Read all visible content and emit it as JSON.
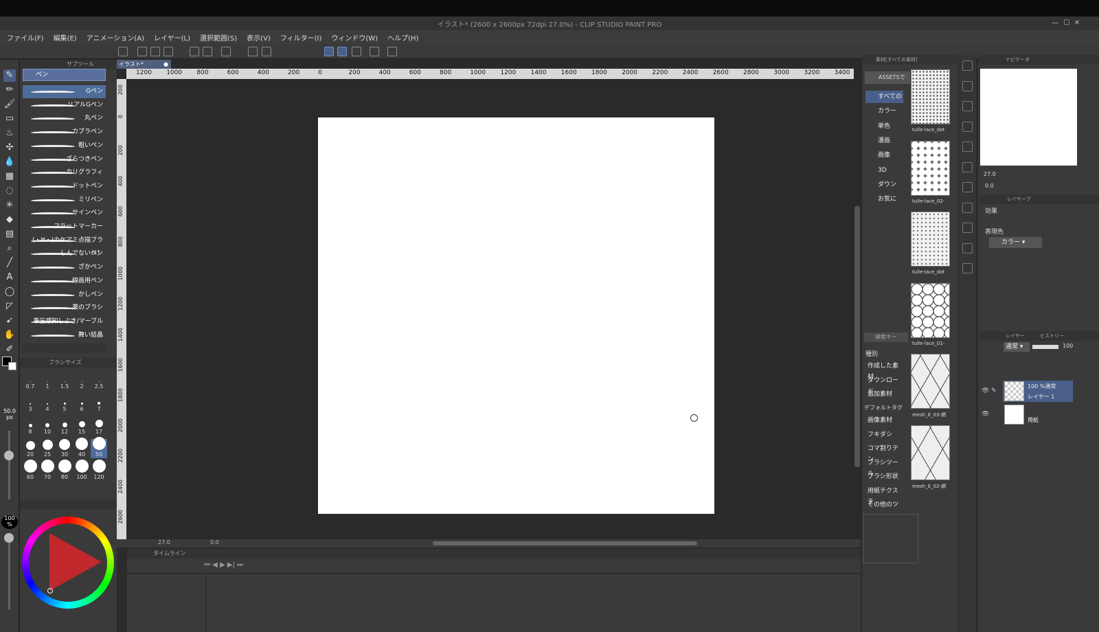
{
  "window": {
    "title": "イラスト* (2600 x 2600px 72dpi 27.0%) - CLIP STUDIO PAINT PRO"
  },
  "menu": [
    "ファイル(F)",
    "編集(E)",
    "アニメーション(A)",
    "レイヤー(L)",
    "選択範囲(S)",
    "表示(V)",
    "フィルター(I)",
    "ウィンドウ(W)",
    "ヘルプ(H)"
  ],
  "sub_tool": {
    "tab": "サブツール",
    "group": "ペン",
    "brushes": [
      "Gペン",
      "リアルGペン",
      "丸ペン",
      "カブラペン",
      "粗いペン",
      "ざらつきペン",
      "カリグラフィ",
      "ドットペン",
      "ミリペン",
      "サインペン",
      "フラットマーカー",
      "(・∀・)カケアミ点描ブラシ！",
      "しんでないペン",
      "ざかペン",
      "線画用ペン",
      "かしペン",
      "薬のブラシ",
      "筆圧感知しぶき/マーブル",
      "舞い結晶"
    ],
    "active_brush": 0
  },
  "brush_size": {
    "tab": "ブラシサイズ",
    "current": "50.0",
    "unit": "px",
    "sizes": [
      "0.7",
      "1",
      "1.5",
      "2",
      "2.5",
      "3",
      "4",
      "5",
      "6",
      "7",
      "8",
      "10",
      "12",
      "15",
      "17",
      "20",
      "25",
      "30",
      "40",
      "50",
      "60",
      "70",
      "80",
      "100",
      "120"
    ],
    "selected": "50"
  },
  "opacity": {
    "value": "100",
    "unit": "%"
  },
  "document": {
    "tab": "イラスト*"
  },
  "ruler_h": [
    "1200",
    "1000",
    "800",
    "600",
    "400",
    "200",
    "0",
    "200",
    "400",
    "600",
    "800",
    "1000",
    "1200",
    "1400",
    "1600",
    "1800",
    "2000",
    "2200",
    "2400",
    "2600",
    "2800",
    "3000",
    "3200",
    "3400"
  ],
  "ruler_v": [
    "200",
    "0",
    "200",
    "400",
    "600",
    "800",
    "1000",
    "1200",
    "1400",
    "1600",
    "1800",
    "2000",
    "2200",
    "2400",
    "2600"
  ],
  "status": {
    "zoom": "27.0",
    "angle": "0.0"
  },
  "timeline": {
    "tab": "タイムライン"
  },
  "materials": {
    "tab": "素材[すべての素材]",
    "assets_label": "ASSETSで",
    "categories": [
      "すべての",
      "カラー",
      "単色",
      "漫画",
      "画像",
      "3D",
      "ダウン",
      "お気に"
    ],
    "search_placeholder": "検索キー",
    "type_label": "種別",
    "types": [
      "作成した素材",
      "ダウンロード",
      "追加素材"
    ],
    "default_tag_label": "デフォルトタグ",
    "tags": [
      "画像素材",
      "フキダシ",
      "コマ割りテン",
      "ブラシツール",
      "ブラシ形状",
      "用紙テクスチ",
      "その他のツ"
    ],
    "thumbs": [
      "tulle-lace_dot",
      "tulle-lace_02-",
      "tulle-lace_dot",
      "tulle-lace_01-",
      "mesh_E_03-網",
      "mesh_E_02-網"
    ]
  },
  "navigator": {
    "tab": "ナビゲータ",
    "zoom": "27.0",
    "angle": "0.0"
  },
  "layer_property": {
    "tab": "レイヤープ",
    "effect_label": "効果",
    "color_label": "表現色",
    "color_value": "カラー"
  },
  "layers": {
    "tabs": [
      "レイヤー",
      "ヒストリー"
    ],
    "blend_mode": "通常",
    "opacity": "100",
    "items": [
      {
        "info": "100 %通常",
        "name": "レイヤー 1"
      },
      {
        "info": "",
        "name": "用紙"
      }
    ]
  }
}
